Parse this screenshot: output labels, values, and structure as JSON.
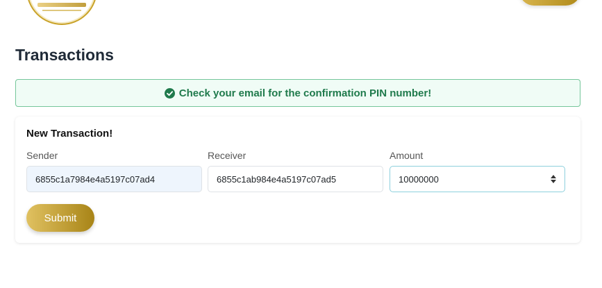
{
  "header": {
    "logo_icon": "brand-logo-icon",
    "page_title": "Transactions"
  },
  "alert": {
    "icon": "check-circle-icon",
    "message": "Check your email for the confirmation PIN number!",
    "color": "#1f7a4c"
  },
  "form": {
    "title": "New Transaction!",
    "sender": {
      "label": "Sender",
      "value": "6855c1a7984e4a5197c07ad4"
    },
    "receiver": {
      "label": "Receiver",
      "value": "6855c1ab984e4a5197c07ad5"
    },
    "amount": {
      "label": "Amount",
      "value": "10000000"
    },
    "submit_label": "Submit"
  },
  "colors": {
    "accent_gold": "#c9a227",
    "success_border": "#75c69a",
    "success_bg": "#f0fcf6"
  }
}
